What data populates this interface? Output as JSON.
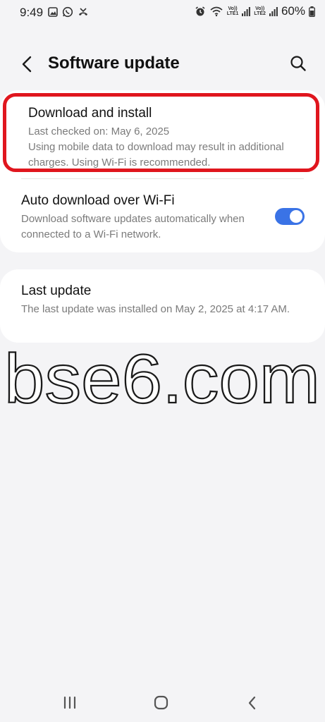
{
  "status_bar": {
    "time": "9:49",
    "battery": "60%",
    "sim1_top": "Vo))",
    "sim1_bottom": "LTE1",
    "sim2_top": "Vo))",
    "sim2_bottom": "LTE2",
    "icons": [
      "gallery-icon",
      "whatsapp-icon",
      "missed-call-icon",
      "alarm-icon",
      "wifi-icon",
      "signal-icon",
      "battery-icon"
    ]
  },
  "header": {
    "title": "Software update",
    "back_icon": "back-arrow-icon",
    "search_icon": "search-icon"
  },
  "download": {
    "title": "Download and install",
    "last_checked": "Last checked on: May 6, 2025",
    "note": "Using mobile data to download may result in additional charges. Using Wi-Fi is recommended."
  },
  "auto_download": {
    "title": "Auto download over Wi-Fi",
    "description": "Download software updates automatically when connected to a Wi-Fi network.",
    "enabled": true,
    "accent": "#3a73e6"
  },
  "last_update": {
    "title": "Last update",
    "description": "The last update was installed on May 2, 2025 at 4:17 AM."
  },
  "watermark": "bse6.com",
  "nav": {
    "recents_icon": "recents-icon",
    "home_icon": "home-icon",
    "back_icon": "back-icon"
  },
  "highlight_color": "#e0161e"
}
